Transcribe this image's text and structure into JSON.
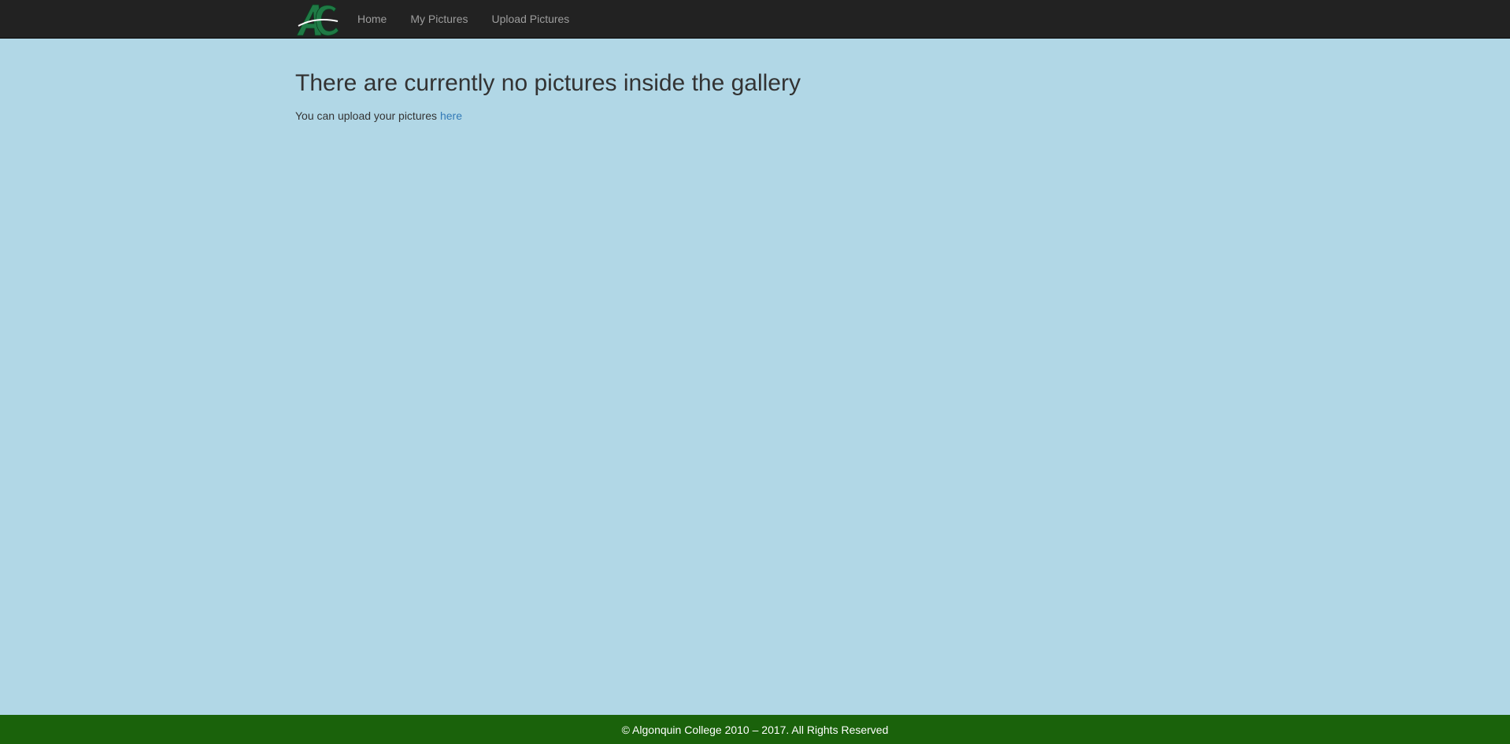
{
  "navbar": {
    "logo_icon": "algonquin-college-ac-logo",
    "logo_text": "AC",
    "items": [
      {
        "label": "Home"
      },
      {
        "label": "My Pictures"
      },
      {
        "label": "Upload Pictures"
      }
    ]
  },
  "main": {
    "heading": "There are currently no pictures inside the gallery",
    "message_prefix": "You can upload your pictures ",
    "message_link": "here"
  },
  "footer": {
    "text": "© Algonquin College 2010 – 2017. All Rights Reserved"
  },
  "colors": {
    "page_background": "#b1d7e6",
    "navbar_background": "#222222",
    "footer_background": "#1a620b",
    "link": "#337ab7",
    "logo_green": "#1f7a45"
  }
}
